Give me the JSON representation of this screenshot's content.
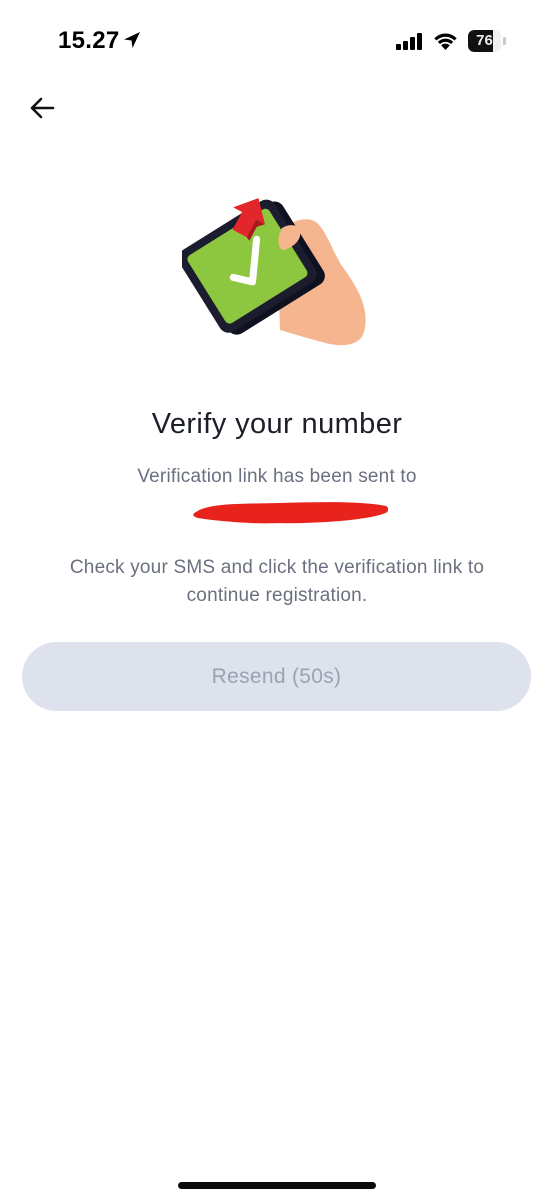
{
  "status_bar": {
    "time": "15.27",
    "location_icon": "location-arrow-icon",
    "signal_icon": "cellular-signal-icon",
    "wifi_icon": "wifi-icon",
    "battery_level": "76",
    "battery_fraction": 0.76
  },
  "nav": {
    "back_icon": "arrow-left-icon"
  },
  "illustration": {
    "description_icon": "phone-verified-icon",
    "colors": {
      "phone_frame": "#1b1d2e",
      "screen": "#8dc63f",
      "check": "#ffffff",
      "arrow": "#e3262b",
      "hand": "#f5b58f"
    }
  },
  "content": {
    "title": "Verify your number",
    "sent_text": "Verification link has been sent to",
    "instruction": "Check your SMS and click the verification link to continue registration."
  },
  "actions": {
    "resend_label": "Resend (50s)",
    "resend_disabled": true
  },
  "colors": {
    "title": "#1c1f2a",
    "body_text": "#6b7080",
    "button_bg": "#dde2ec",
    "button_text": "#9ba2b2",
    "redaction": "#e8231c"
  }
}
